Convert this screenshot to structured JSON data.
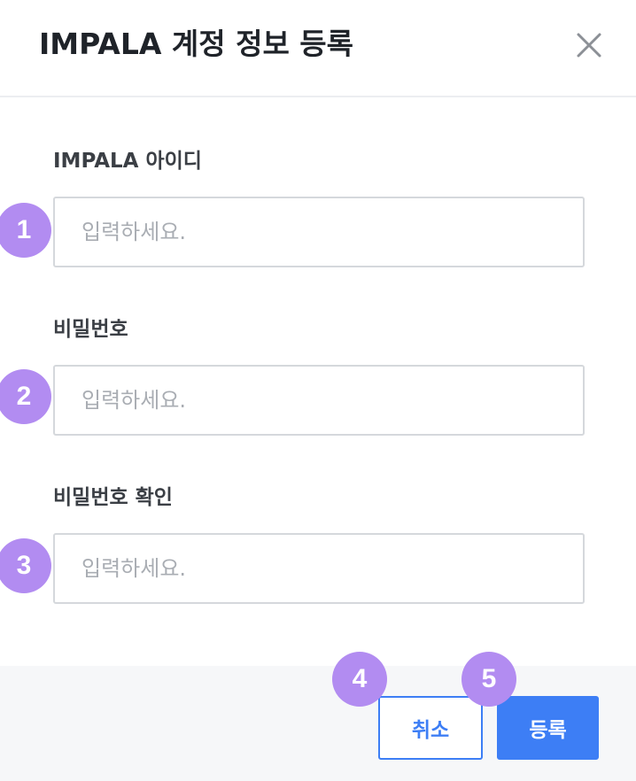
{
  "dialog": {
    "title": "IMPALA 계정 정보 등록",
    "close_icon": "close-icon"
  },
  "fields": [
    {
      "label": "IMPALA 아이디",
      "placeholder": "입력하세요.",
      "value": ""
    },
    {
      "label": "비밀번호",
      "placeholder": "입력하세요.",
      "value": ""
    },
    {
      "label": "비밀번호 확인",
      "placeholder": "입력하세요.",
      "value": ""
    }
  ],
  "buttons": {
    "cancel": "취소",
    "submit": "등록"
  },
  "annotations": [
    "1",
    "2",
    "3",
    "4",
    "5"
  ],
  "colors": {
    "accent": "#3d7ef5",
    "badge": "#b28cf1",
    "footer_bg": "#f6f7f9"
  }
}
